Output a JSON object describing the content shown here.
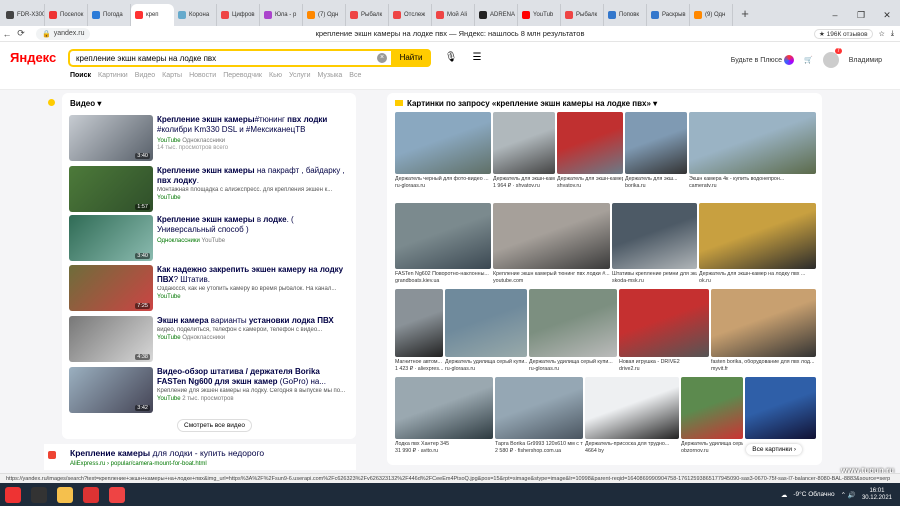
{
  "tabs": [
    {
      "label": "FDR-X3000",
      "color": "#444"
    },
    {
      "label": "Поселок",
      "color": "#e33"
    },
    {
      "label": "Погода",
      "color": "#2b7bd8"
    },
    {
      "label": "креп",
      "color": "#f33",
      "active": true
    },
    {
      "label": "Корона",
      "color": "#6ac"
    },
    {
      "label": "Цифров",
      "color": "#e44"
    },
    {
      "label": "Юла - р",
      "color": "#a4c"
    },
    {
      "label": "(7) Одн",
      "color": "#f80"
    },
    {
      "label": "Рыбалк",
      "color": "#e44"
    },
    {
      "label": "Отслеж",
      "color": "#e44"
    },
    {
      "label": "Мой Ali",
      "color": "#e44"
    },
    {
      "label": "ADRENA",
      "color": "#222"
    },
    {
      "label": "YouTub",
      "color": "#f00"
    },
    {
      "label": "Рыбалк",
      "color": "#e44"
    },
    {
      "label": "Поповк",
      "color": "#37c"
    },
    {
      "label": "Раскрыв",
      "color": "#37c"
    },
    {
      "label": "(9) Одн",
      "color": "#f80"
    }
  ],
  "browser": {
    "url": "yandex.ru",
    "page_title": "крепление экшн камеры на лодке пвх — Яндекс: нашлось 8 млн результатов",
    "reviews": "★ 196К отзывов",
    "new_tab": "+"
  },
  "header": {
    "logo": "Яндекс",
    "query": "крепление экшн камеры на лодке пвх",
    "find": "Найти",
    "plus": "Будьте в Плюсе",
    "user": "Владимир",
    "notif": "7",
    "nav": [
      "Поиск",
      "Картинки",
      "Видео",
      "Карты",
      "Новости",
      "Переводчик",
      "Кью",
      "Услуги",
      "Музыка",
      "Все"
    ]
  },
  "video": {
    "title": "Видео",
    "more": "Смотреть все видео",
    "items": [
      {
        "t1": "Крепление экшн камеры",
        "t2": "#тюнинг ",
        "t3": "пвх лодки",
        "t4": " #колибри Km330 DSL и #МексиканецТВ",
        "desc": "",
        "src": "YouTube",
        "ch": "Одноклассники",
        "meta": "14 тыс. просмотров всего",
        "dur": "3:40"
      },
      {
        "t1": "Крепление экшн камеры",
        "t2": " на пакрафт , байдарку , ",
        "t3": "пвх лодку",
        "t4": ".",
        "desc": "Монтажная площадка с алиэкспресс. для крепления экшен к...",
        "src": "YouTube",
        "ch": "",
        "meta": "",
        "dur": "1:57"
      },
      {
        "t1": "Крепление экшн камеры",
        "t2": " в ",
        "t3": "лодке",
        "t4": ". ( Универсальный способ )",
        "desc": "",
        "src": "Одноклассники",
        "ch": "YouTube",
        "meta": "",
        "dur": "3:40"
      },
      {
        "t1": "Как надежно закрепить ",
        "t2": "",
        "t3": "экшен камеру на лодку ПВХ",
        "t4": "? Штатив.",
        "desc": "Оздаюсся, как не утопить камеру во время рыбалок. На канал...",
        "src": "YouTube",
        "ch": "",
        "meta": "",
        "dur": "7:25"
      },
      {
        "t1": "Экшн камера",
        "t2": " варианты ",
        "t3": "установки лодка ПВХ",
        "t4": "",
        "desc": "видео, поделиться, телефон с камерой, телефон с видео...",
        "src": "YouTube",
        "ch": "Одноклассники",
        "meta": "",
        "dur": "4:38"
      },
      {
        "t1": "Видео-обзор штатива / держателя Borika FASTen Ng600 для ",
        "t2": "",
        "t3": "экшн камер",
        "t4": " (GoPro) на...",
        "desc": "Крепление для экшен камеры на лодку. Сегодня в выпуске мы по...",
        "src": "YouTube",
        "ch": "2 тыс. просмотров",
        "meta": "",
        "dur": "3:42"
      }
    ]
  },
  "ali": {
    "title_a": "Крепление камеры",
    "title_b": " для лодки - купить недорого",
    "url": "AliExpress.ru › popular/camera-mount-for-boat.html"
  },
  "images": {
    "title": "Картинки по запросу «крепление экшн камеры на лодке пвх»",
    "all": "Все картинки",
    "items": [
      {
        "cap": "Держатель черный для фото-видео ...",
        "src": "ru-gloraas.ru",
        "c1": "#8aa8c0",
        "c2": "#5f6f66"
      },
      {
        "cap": "Держатель для экшн-камер...",
        "src": "1 964 ₽ · shvatov.ru",
        "c1": "#b0b8bc",
        "c2": "#444"
      },
      {
        "cap": "Держатель для экшн-камеры и навиг...",
        "src": "shvatov.ru",
        "c1": "#c03030",
        "c2": "#6a7b88"
      },
      {
        "cap": "Держатель для экш...",
        "src": "borika.ru",
        "c1": "#7f9ab3",
        "c2": "#333"
      },
      {
        "cap": "Экшн камера 4к - купить водонепрон...",
        "src": "cameratv.ru",
        "c1": "#9ab3c4",
        "c2": "#5b6a4a"
      },
      {
        "cap": "FASTen Ng602 Поворотно-наклонны...",
        "src": "grandboats.kiev.ua",
        "c1": "#7b8a8e",
        "c2": "#3b4852"
      },
      {
        "cap": "Крепление экшн камерый тюнинг пвх лодки #...",
        "src": "youtube.com",
        "c1": "#a6a09a",
        "c2": "#3a3a3a"
      },
      {
        "cap": "Штативы крепление ремни для экшен...",
        "src": "skoda-msk.ru",
        "c1": "#4d5a66",
        "c2": "#b0b5b8"
      },
      {
        "cap": "Держатель для экшн-камер на лодку пвх ...",
        "src": "ok.ru",
        "c1": "#c8a040",
        "c2": "#2b2b2b"
      },
      {
        "cap": "Магнитное автом...",
        "src": "1 423 ₽ · aliexpres...",
        "c1": "#8a9298",
        "c2": "#222"
      },
      {
        "cap": "Держатель удилища серый купи...",
        "src": "ru-gloraas.ru",
        "c1": "#6f8a9c",
        "c2": "#9aa"
      },
      {
        "cap": "Держатель удилища серый купи...",
        "src": "ru-gloraas.ru",
        "c1": "#7c8f80",
        "c2": "#bbb"
      },
      {
        "cap": "Новая игрушка - DRIVE2",
        "src": "drive2.ru",
        "c1": "#c53030",
        "c2": "#555"
      },
      {
        "cap": "fasten borika, оборудование для пвх лод...",
        "src": "myvit.fr",
        "c1": "#c8a070",
        "c2": "#333"
      },
      {
        "cap": "Лодка пвх Хантер 345",
        "src": "31 990 ₽ · avito.ru",
        "c1": "#9aa8b0",
        "c2": "#2d3a40"
      },
      {
        "cap": "Тарга Borika Gr9993 120х610 мм с треног...",
        "src": "2 580 ₽ · fishershop.com.ua",
        "c1": "#95a7b4",
        "c2": "#4a5560"
      },
      {
        "cap": "Держатель-присоска для трудно...",
        "src": "4664 by",
        "c1": "#eef0f2",
        "c2": "#222"
      },
      {
        "cap": "Держатель удилища серый ку...",
        "src": "obzornov.ru",
        "c1": "#5c8a4e",
        "c2": "#c33"
      },
      {
        "cap": "",
        "src": "",
        "c1": "#2f5fa8",
        "c2": "#113"
      }
    ]
  },
  "status_url": "https://yandex.ru/images/search?text=крепление+экшн+камеры+на+лодке+пвх&img_url=https%3A%2F%2Fsun9-6.userapi.com%2Fc626323%2Fv626323132%2F446d%2FCeeEm4PtsoQ.jpg&pos=15&rpt=simage&stype=image&lr=10998&parent-reqid=1640869990904758-17612593865177945090-sas3-0670-75f-sas-l7-balancer-8080-BAL-8883&source=serp",
  "taskbar": {
    "weather": "-9°C Облачно",
    "time": "16:01",
    "date": "30.12.2021"
  },
  "watermark": "www.tugun.ru"
}
